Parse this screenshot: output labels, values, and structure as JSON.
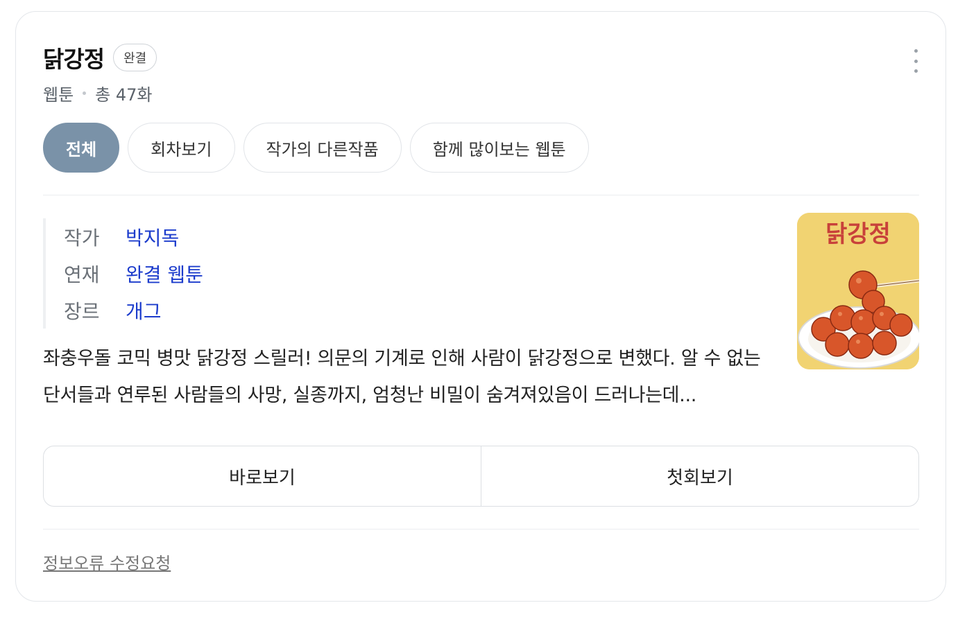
{
  "header": {
    "title": "닭강정",
    "status_badge": "완결",
    "category": "웹툰",
    "episode_count": "총 47화"
  },
  "tabs": [
    {
      "label": "전체",
      "active": true
    },
    {
      "label": "회차보기",
      "active": false
    },
    {
      "label": "작가의 다른작품",
      "active": false
    },
    {
      "label": "함께 많이보는 웹툰",
      "active": false
    }
  ],
  "info": {
    "author_label": "작가",
    "author_value": "박지독",
    "serial_label": "연재",
    "serial_value": "완결 웹툰",
    "genre_label": "장르",
    "genre_value": "개그"
  },
  "description": "좌충우돌 코믹 병맛 닭강정 스릴러! 의문의 기계로 인해 사람이 닭강정으로 변했다. 알 수 없는 단서들과 연루된 사람들의 사망, 실종까지, 엄청난 비밀이 숨겨져있음이 드러나는데...",
  "thumbnail": {
    "title_text": "닭강정",
    "background_color": "#f1d372",
    "title_color": "#c8413a"
  },
  "actions": {
    "read_now": "바로보기",
    "first_episode": "첫회보기"
  },
  "footer": {
    "report_link": "정보오류 수정요청"
  },
  "colors": {
    "accent_tab": "#7a92a8",
    "link": "#1c3ccc"
  }
}
